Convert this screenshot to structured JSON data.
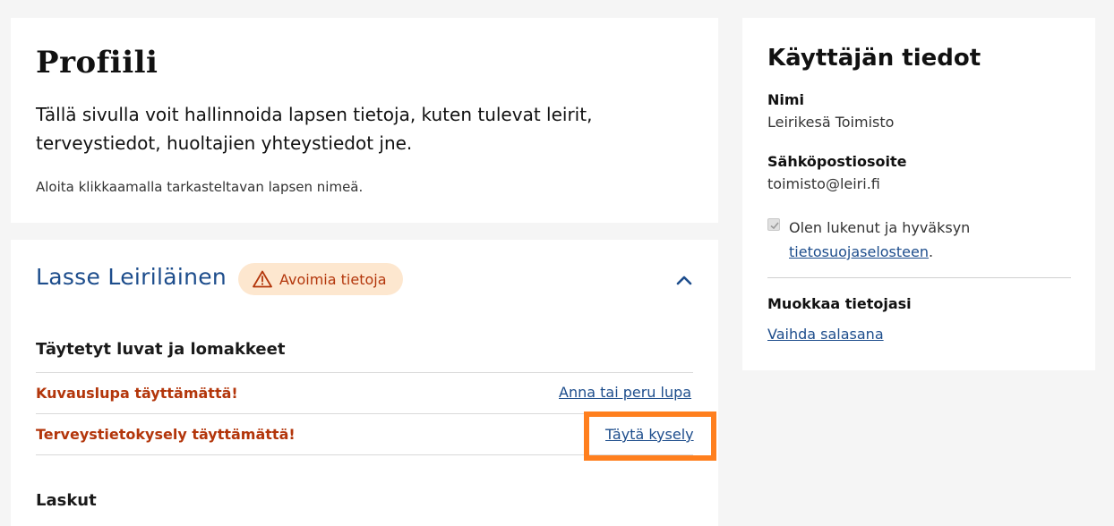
{
  "intro": {
    "title": "Profiili",
    "description": "Tällä sivulla voit hallinnoida lapsen tietoja, kuten tulevat leirit, terveystiedot, huoltajien yhteystiedot jne.",
    "hint": "Aloita klikkaamalla tarkasteltavan lapsen nimeä."
  },
  "child": {
    "name": "Lasse Leiriläinen",
    "badge": "Avoimia tietoja",
    "badge_icon": "warning-triangle-icon",
    "collapse_icon": "chevron-up-icon",
    "forms_heading": "Täytetyt luvat ja lomakkeet",
    "forms": [
      {
        "status": "Kuvauslupa täyttämättä!",
        "action": "Anna tai peru lupa"
      },
      {
        "status": "Terveystietokysely täyttämättä!",
        "action": "Täytä kysely"
      }
    ],
    "invoices_heading": "Laskut"
  },
  "user": {
    "title": "Käyttäjän tiedot",
    "name_label": "Nimi",
    "name_value": "Leirikesä Toimisto",
    "email_label": "Sähköpostiosoite",
    "email_value": "toimisto@leiri.fi",
    "consent_text": "Olen lukenut ja hyväksyn",
    "consent_link": "tietosuojaselosteen",
    "consent_suffix": ".",
    "consent_checked": true,
    "edit_label": "Muokkaa tietojasi",
    "change_password": "Vaihda salasana"
  },
  "colors": {
    "link": "#1d4d8c",
    "warning": "#b3360b",
    "badge_bg": "#fde7cf",
    "highlight": "#ff7f1e"
  }
}
